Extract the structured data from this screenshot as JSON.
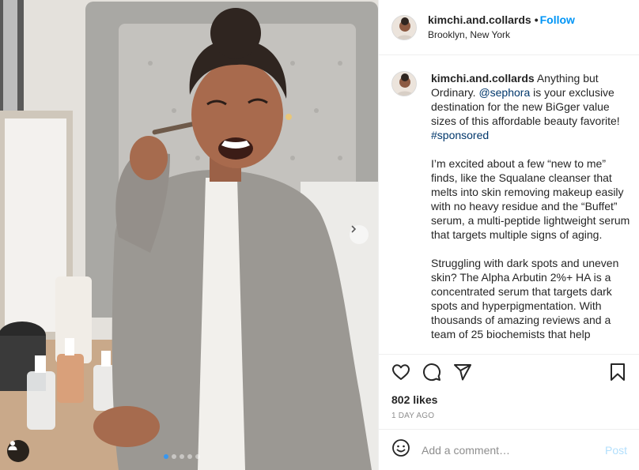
{
  "post": {
    "username": "kimchi.and.collards",
    "follow_label": "Follow",
    "separator": "•",
    "location": "Brooklyn, New York"
  },
  "caption": {
    "username": "kimchi.and.collards",
    "intro_before_mention": " Anything but Ordinary. ",
    "mention": "@sephora",
    "intro_after_mention": " is your exclusive destination for the new BiGger value sizes of this affordable beauty favorite! ",
    "hashtag": "#sponsored",
    "paragraph2": "I’m excited about a few “new to me” finds, like the Squalane cleanser that melts into skin removing makeup easily with no heavy residue and the “Buffet” serum, a multi-peptide lightweight serum that targets multiple signs of aging.",
    "paragraph3": "Struggling with dark spots and uneven skin? The Alpha Arbutin 2%+ HA is a concentrated serum that targets dark spots and hyperpigmentation. With thousands of amazing reviews and a team of 25 biochemists that help"
  },
  "stats": {
    "likes": "802 likes",
    "time": "1 DAY AGO"
  },
  "comment": {
    "placeholder": "Add a comment…",
    "post_label": "Post"
  },
  "carousel": {
    "count": 5,
    "active_index": 0
  },
  "icons": {
    "like": "heart-icon",
    "comment": "comment-bubble-icon",
    "share": "paper-plane-icon",
    "save": "bookmark-icon",
    "emoji": "emoji-icon",
    "tag": "user-tag-icon",
    "next": "chevron-right-icon"
  },
  "colors": {
    "follow": "#0095f6",
    "link": "#00376b",
    "post_disabled": "#b2dffc",
    "active_dot": "#3897f0"
  }
}
